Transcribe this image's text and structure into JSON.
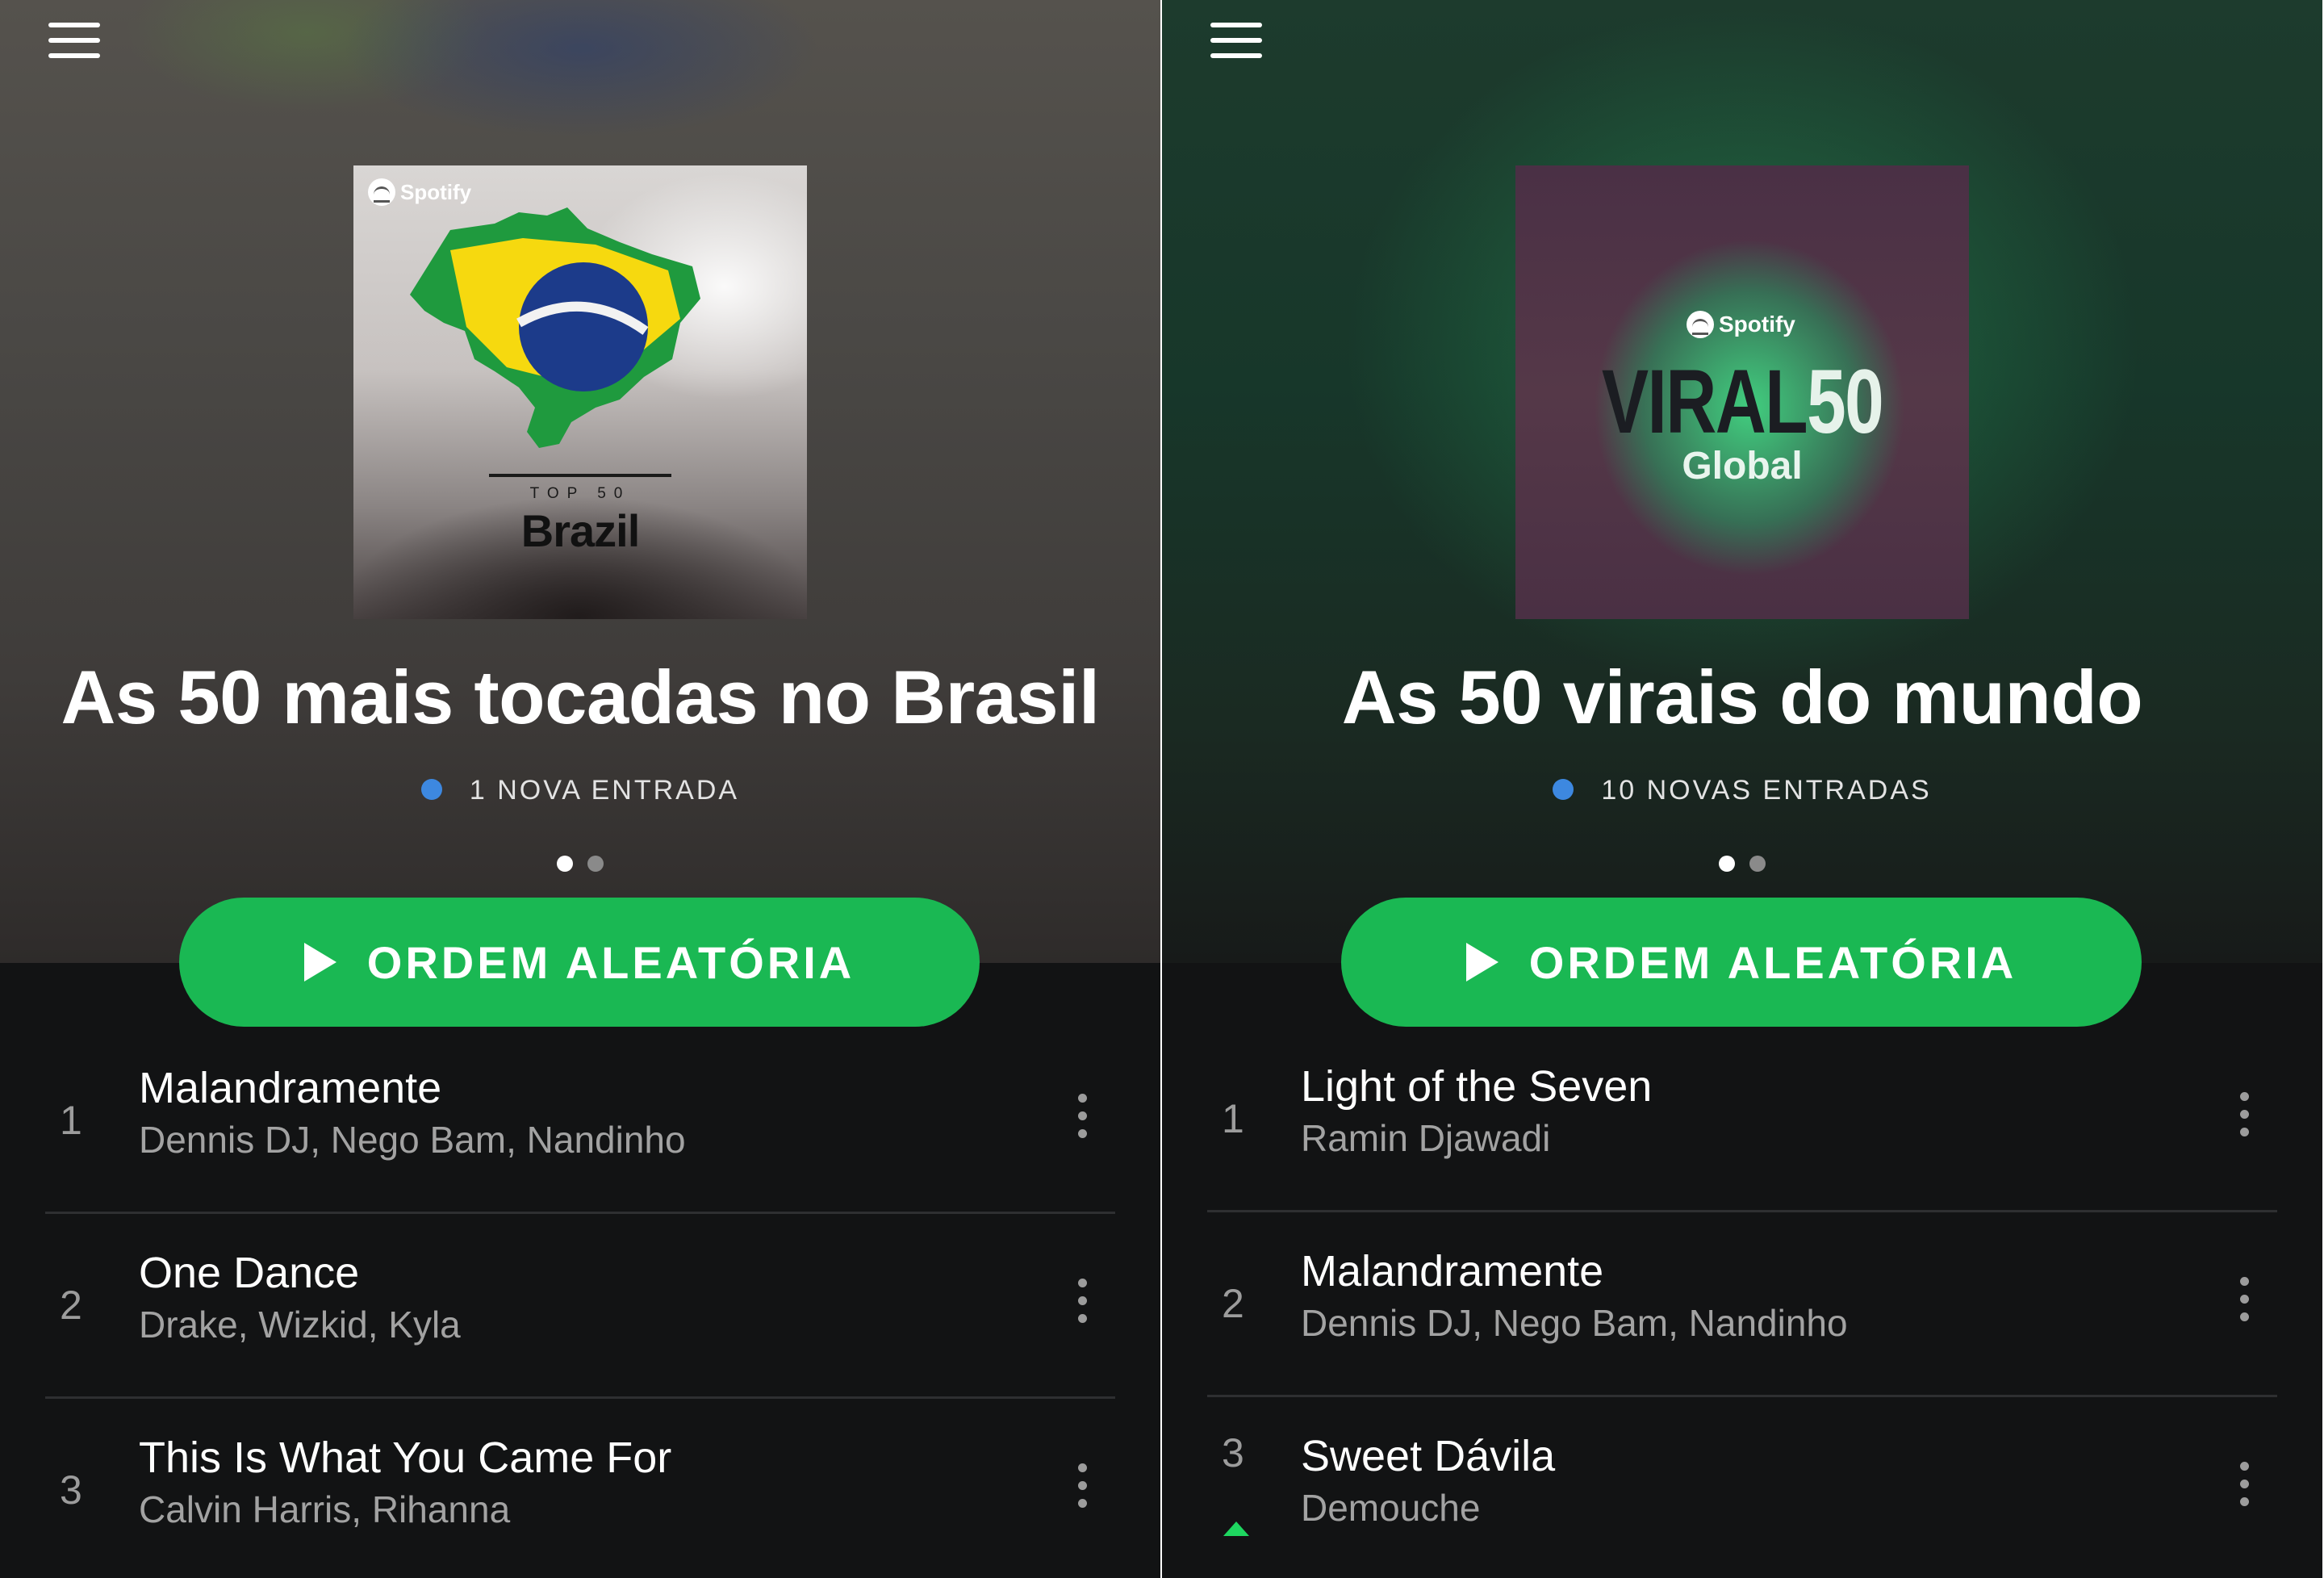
{
  "left": {
    "cover": {
      "brand": "Spotify",
      "top_label": "TOP 50",
      "name": "Brazil"
    },
    "title": "As 50 mais tocadas no Brasil",
    "new_entries": "1 NOVA ENTRADA",
    "shuffle_label": "ORDEM ALEATÓRIA",
    "tracks": [
      {
        "num": "1",
        "title": "Malandramente",
        "artist": "Dennis DJ, Nego Bam, Nandinho"
      },
      {
        "num": "2",
        "title": "One Dance",
        "artist": "Drake, Wizkid, Kyla"
      },
      {
        "num": "3",
        "title": "This Is What You Came For",
        "artist": "Calvin Harris, Rihanna"
      }
    ]
  },
  "right": {
    "cover": {
      "brand": "Spotify",
      "word": "VIRAL",
      "number": "50",
      "sub": "Global"
    },
    "title": "As 50 virais do mundo",
    "new_entries": "10 NOVAS ENTRADAS",
    "shuffle_label": "ORDEM ALEATÓRIA",
    "tracks": [
      {
        "num": "1",
        "title": "Light of the Seven",
        "artist": "Ramin Djawadi"
      },
      {
        "num": "2",
        "title": "Malandramente",
        "artist": "Dennis DJ, Nego Bam, Nandinho"
      },
      {
        "num": "3",
        "title": "Sweet Dávila",
        "artist": "Demouche",
        "trend": "up"
      }
    ]
  },
  "colors": {
    "accent": "#1ab853",
    "new_dot": "#3d88e0",
    "trend_up": "#1ed760",
    "list_bg": "#121314"
  }
}
